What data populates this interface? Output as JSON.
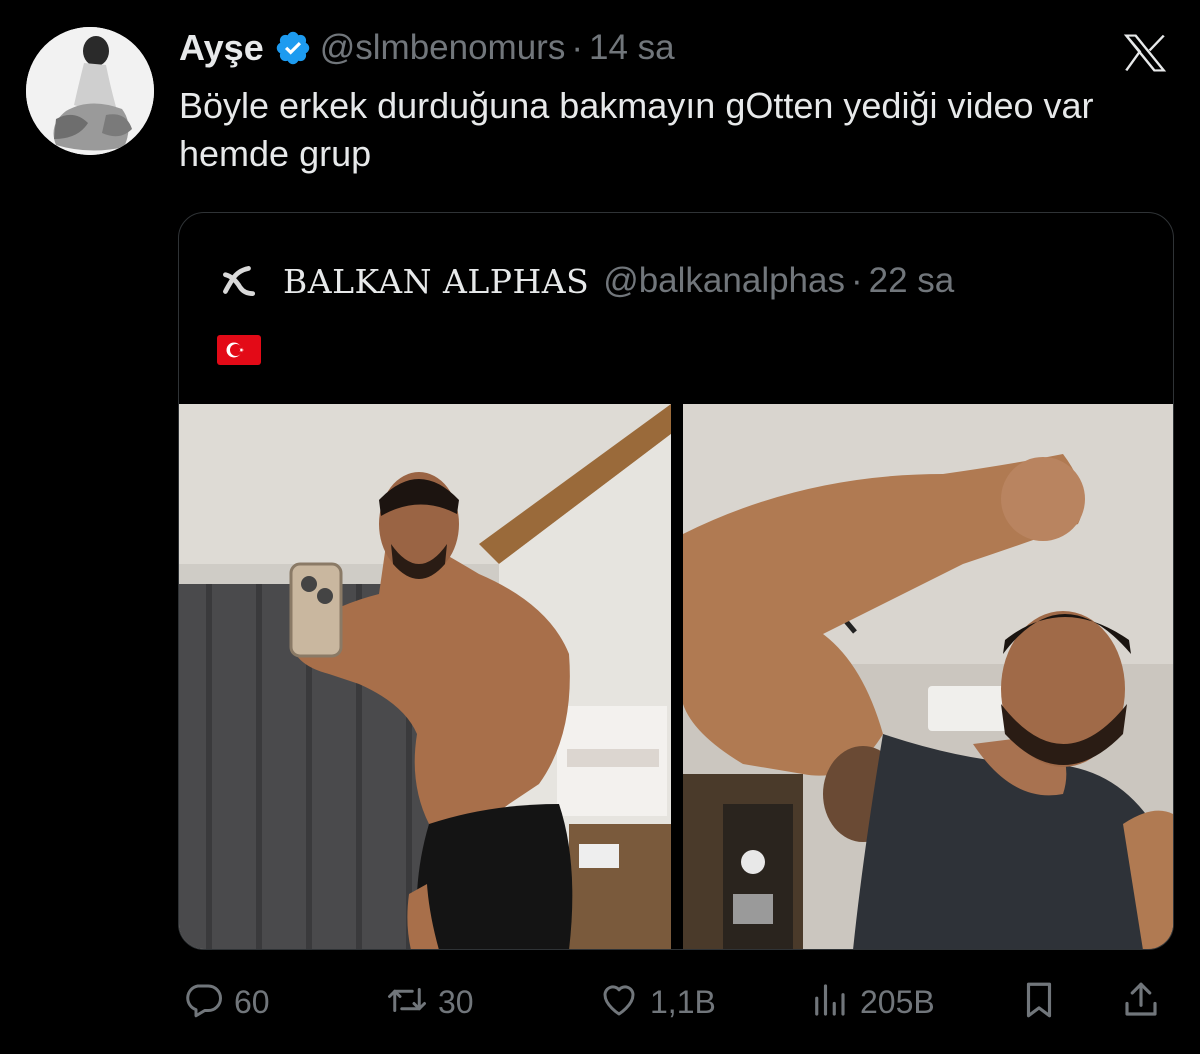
{
  "tweet": {
    "display_name": "Ayşe",
    "verified": true,
    "handle": "@slmbenomurs",
    "separator": "·",
    "time": "14 sa",
    "text": "Böyle erkek durduğuna bakmayın gOtten yediği video var hemde grup",
    "avatar_icon": "profile-avatar"
  },
  "quote": {
    "display_name": "BALKAN ALPHAS",
    "handle": "@balkanalphas",
    "separator": "·",
    "time": "22 sa",
    "flag": "turkey-flag",
    "avatar_icon": "alpha-logo",
    "photos": [
      {
        "label": "mirror-selfie-photo"
      },
      {
        "label": "flexing-selfie-photo"
      }
    ]
  },
  "actions": {
    "replies": "60",
    "reposts": "30",
    "likes": "1,1B",
    "views": "205B"
  },
  "colors": {
    "background": "#000000",
    "text": "#e7e9ea",
    "secondary": "#71767b",
    "verified_blue": "#1d9bf0",
    "border": "#2f3336"
  }
}
